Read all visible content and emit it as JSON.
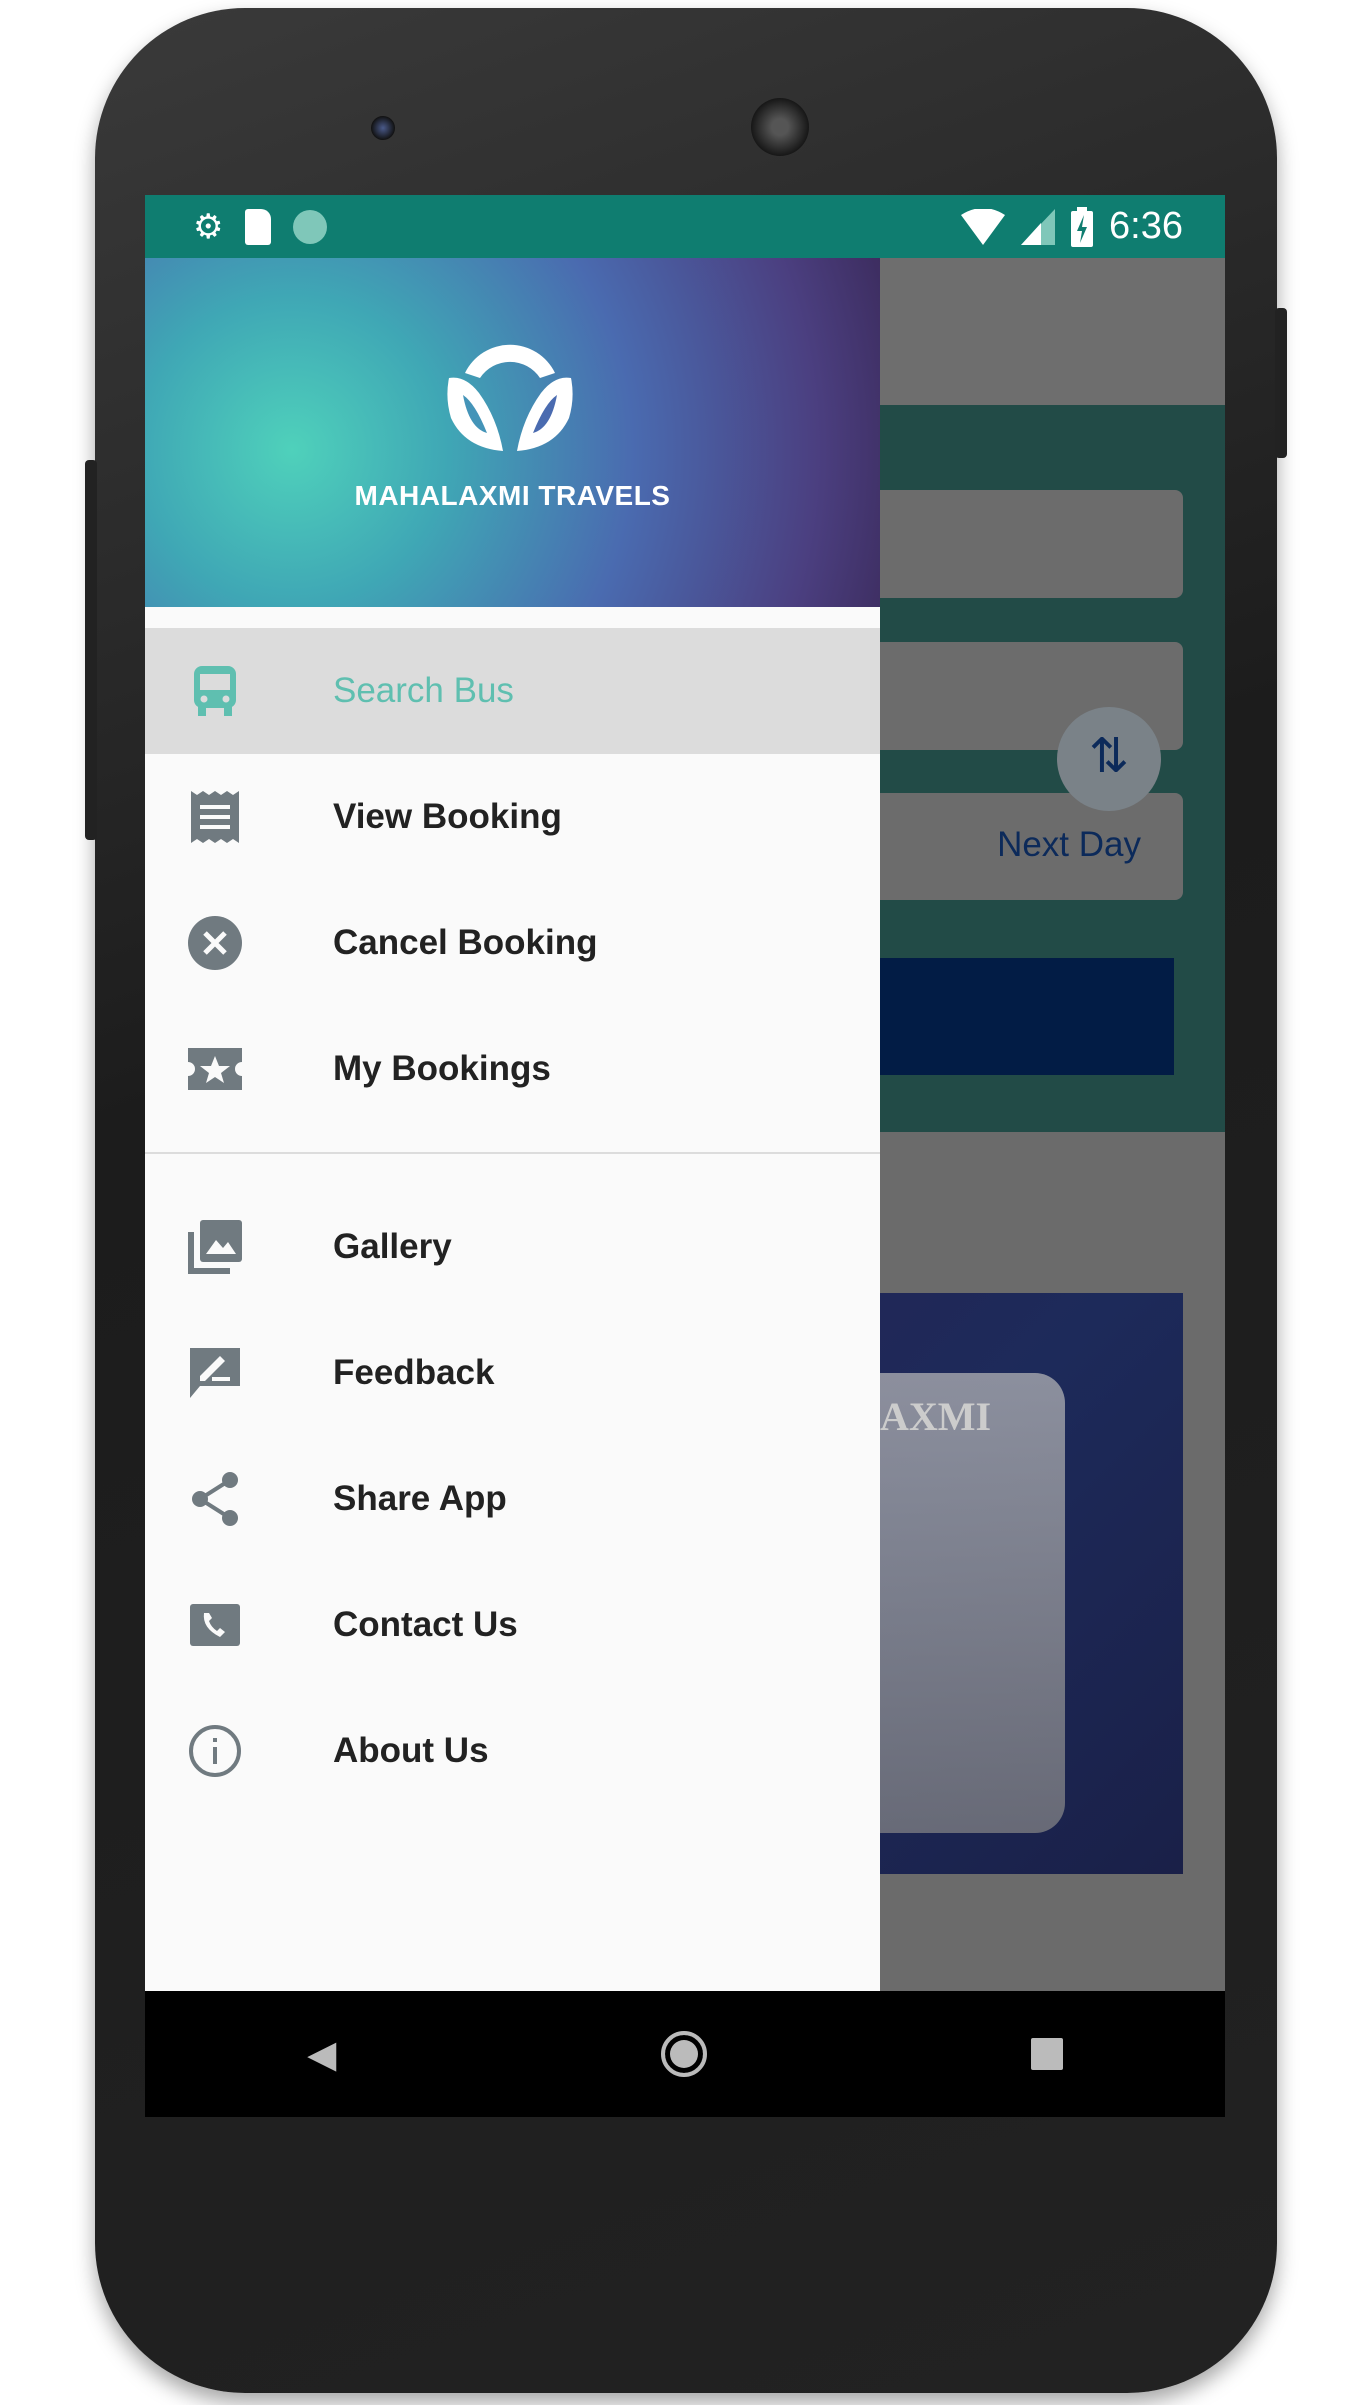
{
  "status_bar": {
    "time": "6:36",
    "left_icons": [
      "gear-icon",
      "sd-card-icon",
      "sync-icon"
    ],
    "right_icons": [
      "wifi-icon",
      "signal-icon",
      "battery-charging-icon"
    ]
  },
  "drawer": {
    "brand": "MAHALAXMI TRAVELS",
    "items": [
      {
        "label": "Search Bus",
        "icon": "bus-icon",
        "active": true
      },
      {
        "label": "View Booking",
        "icon": "receipt-icon"
      },
      {
        "label": "Cancel Booking",
        "icon": "cancel-icon"
      },
      {
        "label": "My Bookings",
        "icon": "ticket-star-icon"
      }
    ],
    "items2": [
      {
        "label": "Gallery",
        "icon": "gallery-icon"
      },
      {
        "label": "Feedback",
        "icon": "feedback-icon"
      },
      {
        "label": "Share App",
        "icon": "share-icon"
      },
      {
        "label": "Contact Us",
        "icon": "phone-icon"
      },
      {
        "label": "About Us",
        "icon": "info-icon"
      }
    ]
  },
  "background": {
    "next_day": "Next Day",
    "bus_text": "AXMI"
  },
  "colors": {
    "status_bar": "#0f7d70",
    "active": "#5fbfb0",
    "button": "#021c45"
  }
}
